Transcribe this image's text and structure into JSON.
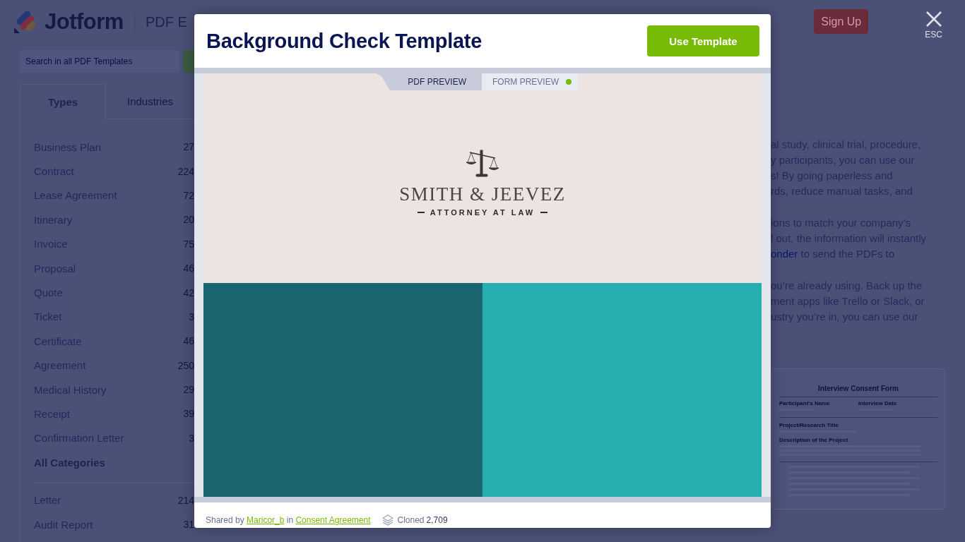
{
  "header": {
    "logo": "Jotform",
    "section": "PDF E",
    "signup": "Sign Up",
    "close_label": "ESC"
  },
  "sidebar": {
    "search": {
      "placeholder": "Search in all PDF Templates"
    },
    "tabs": [
      {
        "label": "Types",
        "selected": true
      },
      {
        "label": "Industries",
        "selected": false
      }
    ],
    "items": [
      {
        "label": "Business Plan",
        "count": "27"
      },
      {
        "label": "Contract",
        "count": "224"
      },
      {
        "label": "Lease Agreement",
        "count": "72"
      },
      {
        "label": "Itinerary",
        "count": "20"
      },
      {
        "label": "Invoice",
        "count": "75"
      },
      {
        "label": "Proposal",
        "count": "46"
      },
      {
        "label": "Quote",
        "count": "42"
      },
      {
        "label": "Ticket",
        "count": "3"
      },
      {
        "label": "Certificate",
        "count": "46"
      },
      {
        "label": "Agreement",
        "count": "250"
      },
      {
        "label": "Medical History",
        "count": "29"
      },
      {
        "label": "Receipt",
        "count": "39"
      },
      {
        "label": "Confirmation Letter",
        "count": "3"
      }
    ],
    "all_categories": "All Categories",
    "more_items": [
      {
        "label": "Letter",
        "count": "214"
      },
      {
        "label": "Audit Report",
        "count": "31"
      }
    ]
  },
  "content": {
    "paragraphs": [
      [
        {
          "text": "al study, clinical trial, procedure,"
        },
        {
          "text": "y participants, you can use our"
        },
        {
          "text": "s! By going paperless and"
        },
        {
          "text": "rds, reduce manual tasks, and"
        }
      ],
      [
        {
          "text": "ions to match your company’s"
        },
        {
          "text": "l out, the information will instantly"
        },
        {
          "link": "onder",
          "text": " to send the PDFs to"
        }
      ],
      [
        {
          "text": "ou’re already using. Back up the"
        },
        {
          "text": "ment apps like Trello or Slack, or"
        },
        {
          "text": "ustry you’re in, you can use our"
        }
      ]
    ]
  },
  "thumbnail": {
    "title": "Interview Consent Form",
    "fields": [
      "Participant's Name",
      "Interview Date"
    ],
    "sections": [
      "Project/Research Title",
      "Description of the Project"
    ]
  },
  "modal": {
    "title": "Background Check Template",
    "button": "Use Template",
    "tabs": [
      {
        "label": "PDF PREVIEW",
        "selected": true
      },
      {
        "label": "FORM PREVIEW",
        "selected": false
      }
    ],
    "document": {
      "firm": "SMITH & JEEVEZ",
      "tagline": "ATTORNEY AT LAW"
    },
    "footer": {
      "shared_by": "Shared by",
      "author": "Maricor_b",
      "in": "in",
      "category": "Consent Agreement",
      "cloned_label": "Cloned",
      "cloned_count": "2,709"
    }
  }
}
